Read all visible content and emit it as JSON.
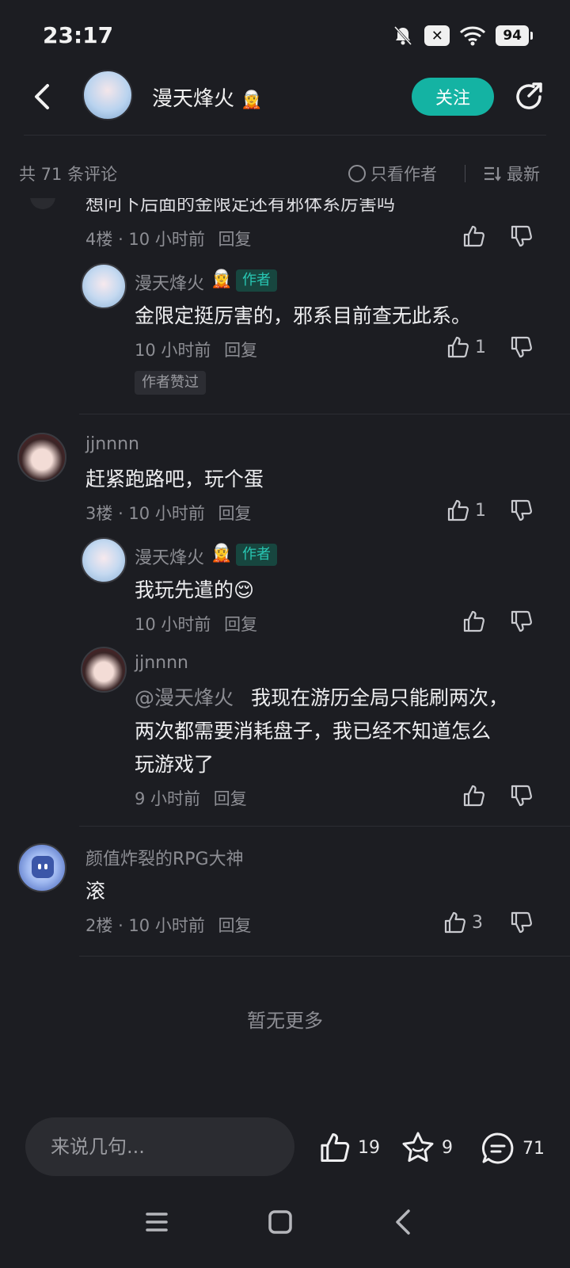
{
  "status_bar": {
    "time": "23:17",
    "battery": "94",
    "x_badge": "✕"
  },
  "header": {
    "author_name": "漫天烽火",
    "follow_label": "关注"
  },
  "comment_bar": {
    "count_label": "共 71 条评论",
    "author_only_label": "只看作者",
    "sort_label": "最新"
  },
  "comments": [
    {
      "cut_text": "想问下后面的金限定还有邪体系厉害吗",
      "floor": "4楼",
      "time": "10 小时前",
      "reply_label": "回复",
      "replies": [
        {
          "user": "漫天烽火",
          "tag": "作者",
          "text": "金限定挺厉害的，邪系目前查无此系。",
          "time": "10 小时前",
          "reply_label": "回复",
          "likes": "1",
          "badge": "作者赞过"
        }
      ]
    },
    {
      "user": "jjnnnn",
      "text": "赶紧跑路吧，玩个蛋",
      "floor": "3楼",
      "time": "10 小时前",
      "reply_label": "回复",
      "likes": "1",
      "replies": [
        {
          "user": "漫天烽火",
          "tag": "作者",
          "text": "我玩先遣的😌",
          "time": "10 小时前",
          "reply_label": "回复"
        },
        {
          "user": "jjnnnn",
          "mention": "@漫天烽火",
          "text_line1": "我现在游历全局只能刷两次，",
          "text_line2": "两次都需要消耗盘子，我已经不知道怎么",
          "text_line3": "玩游戏了",
          "time": "9 小时前",
          "reply_label": "回复"
        }
      ]
    },
    {
      "user": "颜值炸裂的RPG大神",
      "text": "滚",
      "floor": "2楼",
      "time": "10 小时前",
      "reply_label": "回复",
      "likes": "3"
    }
  ],
  "no_more": "暂无更多",
  "bottom_bar": {
    "input_placeholder": "来说几句...",
    "likes": "19",
    "favorites": "9",
    "comments": "71"
  },
  "icons": {
    "back": "back-arrow-icon",
    "share": "share-icon",
    "like": "thumbs-up-icon",
    "dislike": "thumbs-down-icon",
    "star": "star-icon",
    "comment": "comment-bubble-icon"
  },
  "colors": {
    "accent": "#14b3a3",
    "background": "#1c1d22",
    "author_tag": "#28c7b3"
  }
}
